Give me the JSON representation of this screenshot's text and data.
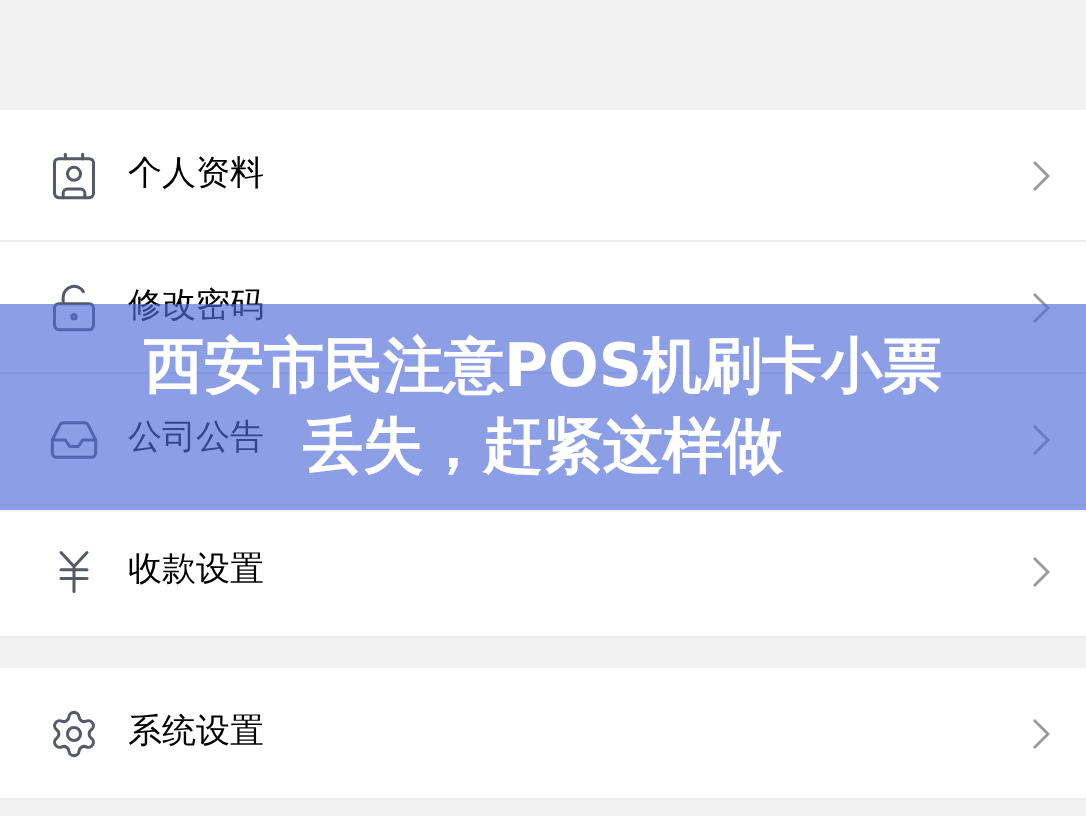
{
  "sections": [
    {
      "items": [
        {
          "label": "个人资料"
        },
        {
          "label": "修改密码"
        },
        {
          "label": "公司公告"
        },
        {
          "label": "收款设置"
        }
      ]
    },
    {
      "items": [
        {
          "label": "系统设置"
        }
      ]
    }
  ],
  "banner": {
    "lines": [
      "西安市民注意POS机刷卡小票",
      "丢失，赶紧这样做"
    ]
  }
}
